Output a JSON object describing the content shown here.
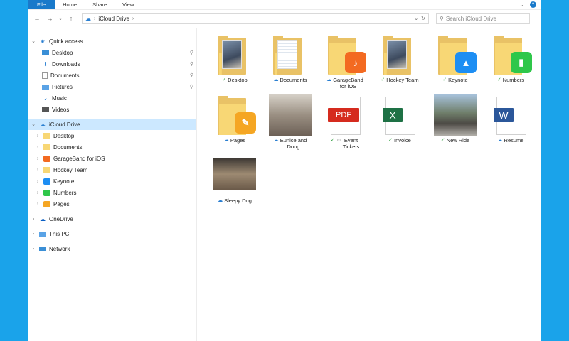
{
  "ribbon": {
    "tabs": [
      "File",
      "Home",
      "Share",
      "View"
    ]
  },
  "address": {
    "path_root": "iCloud Drive",
    "search_placeholder": "Search iCloud Drive"
  },
  "nav": {
    "quick_access": "Quick access",
    "quick_items": [
      "Desktop",
      "Downloads",
      "Documents",
      "Pictures",
      "Music",
      "Videos"
    ],
    "icloud": "iCloud Drive",
    "icloud_items": [
      "Desktop",
      "Documents",
      "GarageBand for iOS",
      "Hockey Team",
      "Keynote",
      "Numbers",
      "Pages"
    ],
    "onedrive": "OneDrive",
    "thispc": "This PC",
    "network": "Network"
  },
  "files": [
    {
      "line1": "Desktop",
      "line2": "",
      "status": "ok",
      "kind": "folder-photo"
    },
    {
      "line1": "Documents",
      "line2": "",
      "status": "cloud",
      "kind": "folder-docs"
    },
    {
      "line1": "GarageBand",
      "line2": "for iOS",
      "status": "cloud",
      "kind": "folder-garageband",
      "badge_color": "#f36a21"
    },
    {
      "line1": "Hockey Team",
      "line2": "",
      "status": "ok",
      "kind": "folder-photo"
    },
    {
      "line1": "Keynote",
      "line2": "",
      "status": "ok",
      "kind": "folder-keynote",
      "badge_color": "#1d8ef3"
    },
    {
      "line1": "Numbers",
      "line2": "",
      "status": "ok",
      "kind": "folder-numbers",
      "badge_color": "#2fc74a"
    },
    {
      "line1": "Pages",
      "line2": "",
      "status": "cloud",
      "kind": "folder-pages",
      "badge_color": "#f5a623"
    },
    {
      "line1": "Eunice and",
      "line2": "Doug",
      "status": "cloud",
      "kind": "photo"
    },
    {
      "line1": "Event",
      "line2": "Tickets",
      "status": "ok-shared",
      "kind": "pdf",
      "badge_text": "PDF",
      "badge_color": "#d52b1e"
    },
    {
      "line1": "Invoice",
      "line2": "",
      "status": "ok",
      "kind": "excel",
      "badge_text": "X",
      "badge_color": "#1e7145"
    },
    {
      "line1": "New Ride",
      "line2": "",
      "status": "ok",
      "kind": "photo"
    },
    {
      "line1": "Resume",
      "line2": "",
      "status": "cloud",
      "kind": "word",
      "badge_text": "W",
      "badge_color": "#2b579a"
    },
    {
      "line1": "Sleepy Dog",
      "line2": "",
      "status": "cloud",
      "kind": "photo"
    }
  ]
}
